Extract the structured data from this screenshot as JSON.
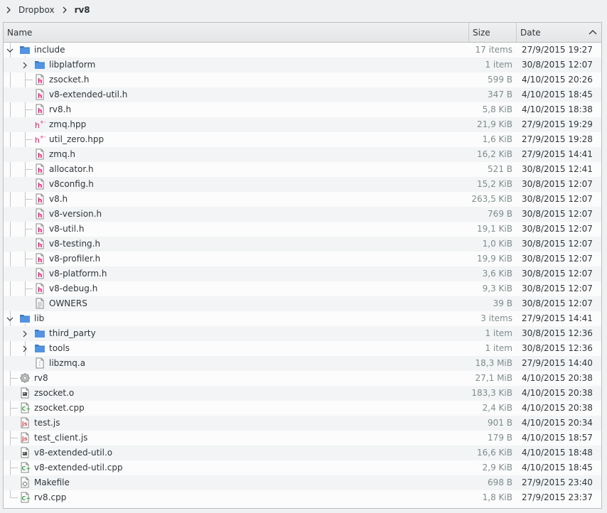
{
  "breadcrumb": {
    "items": [
      {
        "label": "Dropbox"
      },
      {
        "label": "rv8"
      }
    ]
  },
  "header": {
    "name_label": "Name",
    "size_label": "Size",
    "date_label": "Date",
    "sort_icon": "chevron-up-icon"
  },
  "rows": [
    {
      "name": "include",
      "size": "17 items",
      "date": "27/9/2015 19:27",
      "level": 0,
      "icon": "folder-icon",
      "expander": "open"
    },
    {
      "name": "libplatform",
      "size": "1 item",
      "date": "30/8/2015 12:07",
      "level": 1,
      "icon": "folder-icon",
      "expander": "closed"
    },
    {
      "name": "zsocket.h",
      "size": "599 B",
      "date": "4/10/2015 20:26",
      "level": 1,
      "icon": "header-file-icon"
    },
    {
      "name": "v8-extended-util.h",
      "size": "347 B",
      "date": "4/10/2015 18:45",
      "level": 1,
      "icon": "header-file-icon"
    },
    {
      "name": "rv8.h",
      "size": "5,8 KiB",
      "date": "4/10/2015 18:38",
      "level": 1,
      "icon": "header-file-icon"
    },
    {
      "name": "zmq.hpp",
      "size": "21,9 KiB",
      "date": "27/9/2015 19:29",
      "level": 1,
      "icon": "cpp-header-icon"
    },
    {
      "name": "util_zero.hpp",
      "size": "1,6 KiB",
      "date": "27/9/2015 19:28",
      "level": 1,
      "icon": "cpp-header-icon"
    },
    {
      "name": "zmq.h",
      "size": "16,2 KiB",
      "date": "27/9/2015 14:41",
      "level": 1,
      "icon": "header-file-icon"
    },
    {
      "name": "allocator.h",
      "size": "521 B",
      "date": "30/8/2015 12:41",
      "level": 1,
      "icon": "header-file-icon"
    },
    {
      "name": "v8config.h",
      "size": "15,2 KiB",
      "date": "30/8/2015 12:07",
      "level": 1,
      "icon": "header-file-icon"
    },
    {
      "name": "v8.h",
      "size": "263,5 KiB",
      "date": "30/8/2015 12:07",
      "level": 1,
      "icon": "header-file-icon"
    },
    {
      "name": "v8-version.h",
      "size": "769 B",
      "date": "30/8/2015 12:07",
      "level": 1,
      "icon": "header-file-icon"
    },
    {
      "name": "v8-util.h",
      "size": "19,1 KiB",
      "date": "30/8/2015 12:07",
      "level": 1,
      "icon": "header-file-icon"
    },
    {
      "name": "v8-testing.h",
      "size": "1,0 KiB",
      "date": "30/8/2015 12:07",
      "level": 1,
      "icon": "header-file-icon"
    },
    {
      "name": "v8-profiler.h",
      "size": "19,9 KiB",
      "date": "30/8/2015 12:07",
      "level": 1,
      "icon": "header-file-icon"
    },
    {
      "name": "v8-platform.h",
      "size": "3,6 KiB",
      "date": "30/8/2015 12:07",
      "level": 1,
      "icon": "header-file-icon"
    },
    {
      "name": "v8-debug.h",
      "size": "9,3 KiB",
      "date": "30/8/2015 12:07",
      "level": 1,
      "icon": "header-file-icon"
    },
    {
      "name": "OWNERS",
      "size": "39 B",
      "date": "30/8/2015 12:07",
      "level": 1,
      "icon": "text-file-icon"
    },
    {
      "name": "lib",
      "size": "3 items",
      "date": "27/9/2015 14:41",
      "level": 0,
      "icon": "folder-icon",
      "expander": "open"
    },
    {
      "name": "third_party",
      "size": "1 item",
      "date": "30/8/2015 12:36",
      "level": 1,
      "icon": "folder-icon",
      "expander": "closed"
    },
    {
      "name": "tools",
      "size": "1 item",
      "date": "30/8/2015 12:36",
      "level": 1,
      "icon": "folder-icon",
      "expander": "closed"
    },
    {
      "name": "libzmq.a",
      "size": "18,3 MiB",
      "date": "27/9/2015 14:40",
      "level": 1,
      "icon": "archive-file-icon"
    },
    {
      "name": "rv8",
      "size": "27,1 MiB",
      "date": "4/10/2015 20:38",
      "level": 0,
      "icon": "executable-icon"
    },
    {
      "name": "zsocket.o",
      "size": "183,3 KiB",
      "date": "4/10/2015 20:38",
      "level": 0,
      "icon": "object-file-icon"
    },
    {
      "name": "zsocket.cpp",
      "size": "2,4 KiB",
      "date": "4/10/2015 20:38",
      "level": 0,
      "icon": "cpp-source-icon"
    },
    {
      "name": "test.js",
      "size": "901 B",
      "date": "4/10/2015 20:34",
      "level": 0,
      "icon": "javascript-file-icon"
    },
    {
      "name": "test_client.js",
      "size": "179 B",
      "date": "4/10/2015 18:57",
      "level": 0,
      "icon": "javascript-file-icon"
    },
    {
      "name": "v8-extended-util.o",
      "size": "16,6 KiB",
      "date": "4/10/2015 18:48",
      "level": 0,
      "icon": "object-file-icon"
    },
    {
      "name": "v8-extended-util.cpp",
      "size": "2,9 KiB",
      "date": "4/10/2015 18:45",
      "level": 0,
      "icon": "cpp-source-icon"
    },
    {
      "name": "Makefile",
      "size": "698 B",
      "date": "27/9/2015 23:40",
      "level": 0,
      "icon": "makefile-icon"
    },
    {
      "name": "rv8.cpp",
      "size": "1,8 KiB",
      "date": "27/9/2015 23:37",
      "level": 0,
      "icon": "cpp-source-icon"
    }
  ],
  "colors": {
    "folder": "#5294e2",
    "folder_dark": "#3b7ac4",
    "header_accent": "#e0136d",
    "cpp_green": "#3fa34d",
    "js_red": "#d94545",
    "text": "#31363b",
    "muted": "#7f8c8d"
  }
}
